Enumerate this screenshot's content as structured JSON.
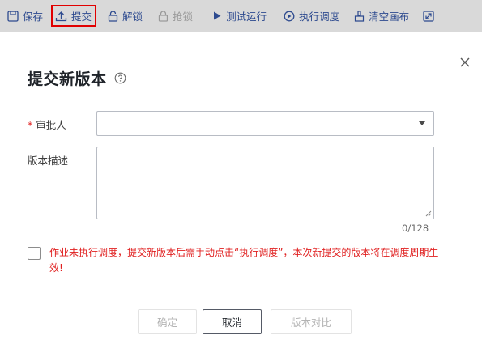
{
  "toolbar": {
    "items": [
      {
        "label": "保存",
        "icon": "save-icon"
      },
      {
        "label": "提交",
        "icon": "upload-icon"
      },
      {
        "label": "解锁",
        "icon": "unlock-icon"
      },
      {
        "label": "抢锁",
        "icon": "lock-icon"
      },
      {
        "label": "测试运行",
        "icon": "play-icon"
      },
      {
        "label": "执行调度",
        "icon": "circle-play-icon"
      },
      {
        "label": "清空画布",
        "icon": "brush-icon"
      }
    ],
    "expand_icon": "expand-icon"
  },
  "modal": {
    "title": "提交新版本",
    "close_icon": "close-icon",
    "help_icon": "question-circle-icon",
    "approver": {
      "required_mark": "*",
      "label": "审批人",
      "value": ""
    },
    "description": {
      "label": "版本描述",
      "value": "",
      "counter": "0/128"
    },
    "notice": "作业未执行调度，提交新版本后需手动点击“执行调度”，本次新提交的版本将在调度周期生效!",
    "buttons": {
      "confirm": "确定",
      "cancel": "取消",
      "compare": "版本对比"
    }
  },
  "colors": {
    "toolbar_bg": "#d9d9d9",
    "highlight_border": "#e10000",
    "required": "#e02020",
    "notice_text": "#e02020",
    "toolbar_text": "#2d4a8f"
  }
}
